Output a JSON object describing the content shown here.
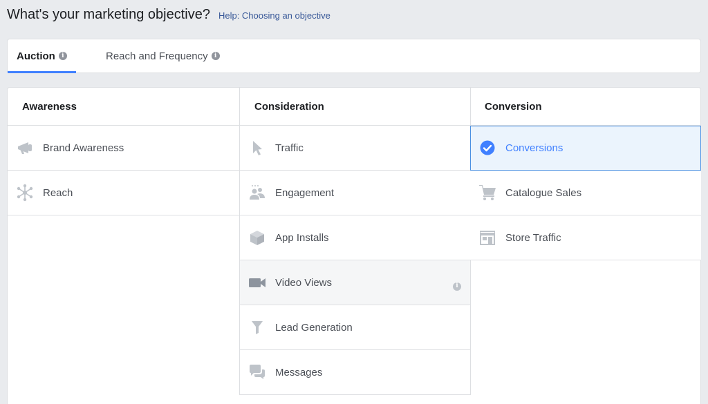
{
  "header": {
    "title": "What's your marketing objective?",
    "help_link": "Help: Choosing an objective"
  },
  "tabs": [
    {
      "label": "Auction",
      "active": true
    },
    {
      "label": "Reach and Frequency",
      "active": false
    }
  ],
  "columns": [
    {
      "heading": "Awareness",
      "items": [
        {
          "label": "Brand Awareness",
          "icon": "megaphone-icon"
        },
        {
          "label": "Reach",
          "icon": "reach-icon"
        }
      ]
    },
    {
      "heading": "Consideration",
      "items": [
        {
          "label": "Traffic",
          "icon": "cursor-icon"
        },
        {
          "label": "Engagement",
          "icon": "people-icon"
        },
        {
          "label": "App Installs",
          "icon": "box-icon"
        },
        {
          "label": "Video Views",
          "icon": "video-camera-icon",
          "state": "hover"
        },
        {
          "label": "Lead Generation",
          "icon": "funnel-icon"
        },
        {
          "label": "Messages",
          "icon": "chat-bubbles-icon"
        }
      ]
    },
    {
      "heading": "Conversion",
      "items": [
        {
          "label": "Conversions",
          "icon": "checkmark-circle-icon",
          "state": "selected"
        },
        {
          "label": "Catalogue Sales",
          "icon": "shopping-cart-icon"
        },
        {
          "label": "Store Traffic",
          "icon": "storefront-icon"
        }
      ]
    }
  ],
  "colors": {
    "accent": "#4080ff",
    "selected_bg": "#ebf4fd",
    "icon_gray": "#bec3c9",
    "page_bg": "#e9ebee"
  }
}
